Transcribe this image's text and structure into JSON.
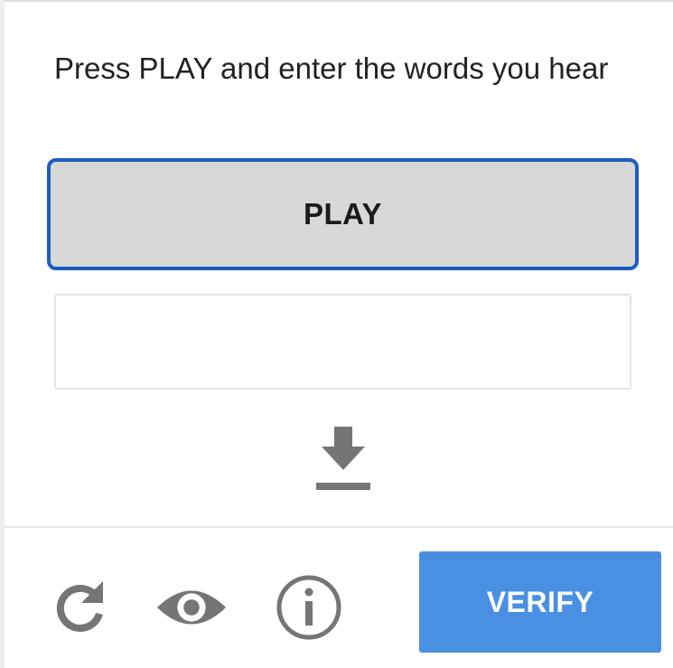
{
  "challenge": {
    "instruction": "Press PLAY and enter the words you hear",
    "play_label": "PLAY",
    "answer_value": "",
    "download_icon": "download-arrow-icon"
  },
  "footer": {
    "reload_icon": "reload-icon",
    "visual_icon": "eye-icon",
    "info_icon": "info-icon",
    "verify_label": "VERIFY"
  },
  "colors": {
    "play_border": "#1a5dbf",
    "play_background": "#d8d8d8",
    "verify_background": "#4a90e2",
    "icon_gray": "#757575"
  }
}
